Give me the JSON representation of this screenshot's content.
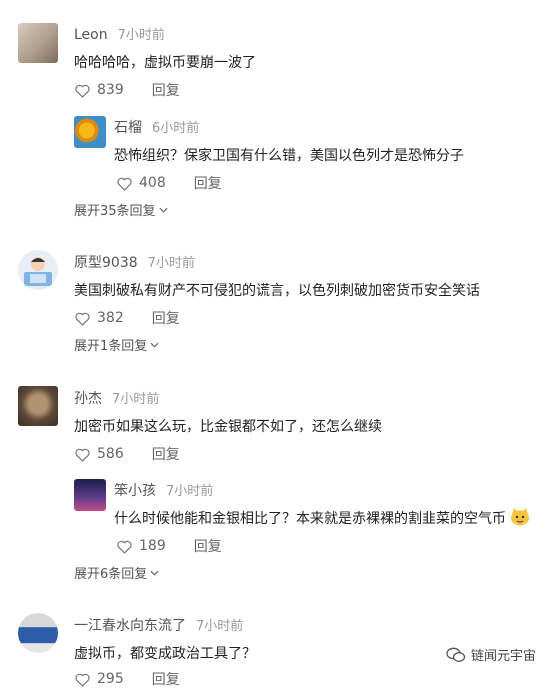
{
  "comments": [
    {
      "name": "Leon",
      "time": "7小时前",
      "text": "哈哈哈哈，虚拟币要崩一波了",
      "likes": "839",
      "reply_label": "回复",
      "sub": {
        "name": "石榴",
        "time": "6小时前",
        "text": "恐怖组织？保家卫国有什么错，美国以色列才是恐怖分子",
        "likes": "408",
        "reply_label": "回复"
      },
      "expand": "展开35条回复"
    },
    {
      "name": "原型9038",
      "time": "7小时前",
      "text": "美国刺破私有财产不可侵犯的谎言，以色列刺破加密货币安全笑话",
      "likes": "382",
      "reply_label": "回复",
      "expand": "展开1条回复"
    },
    {
      "name": "孙杰",
      "time": "7小时前",
      "text": "加密币如果这么玩，比金银都不如了，还怎么继续",
      "likes": "586",
      "reply_label": "回复",
      "sub": {
        "name": "笨小孩",
        "time": "7小时前",
        "text": "什么时候他能和金银相比了？本来就是赤裸裸的割韭菜的空气币",
        "likes": "189",
        "reply_label": "回复"
      },
      "expand": "展开6条回复"
    },
    {
      "name": "一江春水向东流了",
      "time": "7小时前",
      "text": "虚拟币，都变成政治工具了？",
      "likes": "295",
      "reply_label": "回复"
    }
  ],
  "watermark": "链闻元宇宙"
}
